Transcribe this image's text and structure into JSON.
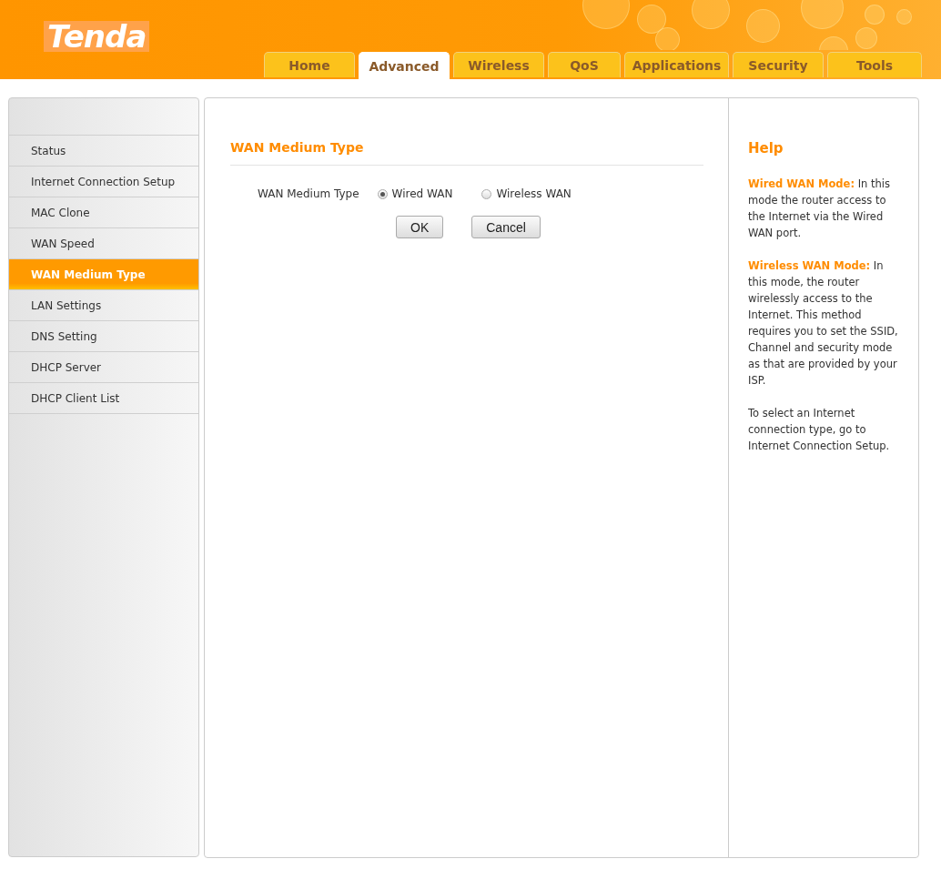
{
  "logo": "Tenda",
  "tabs": [
    {
      "label": "Home",
      "selected": false
    },
    {
      "label": "Advanced",
      "selected": true
    },
    {
      "label": "Wireless",
      "selected": false
    },
    {
      "label": "QoS",
      "selected": false
    },
    {
      "label": "Applications",
      "selected": false
    },
    {
      "label": "Security",
      "selected": false
    },
    {
      "label": "Tools",
      "selected": false
    }
  ],
  "sidebar": {
    "items": [
      {
        "label": "Status",
        "selected": false
      },
      {
        "label": "Internet Connection Setup",
        "selected": false
      },
      {
        "label": "MAC Clone",
        "selected": false
      },
      {
        "label": "WAN Speed",
        "selected": false
      },
      {
        "label": "WAN Medium Type",
        "selected": true
      },
      {
        "label": "LAN Settings",
        "selected": false
      },
      {
        "label": "DNS Setting",
        "selected": false
      },
      {
        "label": "DHCP Server",
        "selected": false
      },
      {
        "label": "DHCP Client List",
        "selected": false
      }
    ]
  },
  "form": {
    "title": "WAN Medium Type",
    "field_label": "WAN Medium Type",
    "options": [
      {
        "label": "Wired WAN",
        "selected": true
      },
      {
        "label": "Wireless WAN",
        "selected": false
      }
    ],
    "buttons": [
      "OK",
      "Cancel"
    ]
  },
  "help": {
    "title": "Help",
    "paragraphs": [
      "**Wired WAN Mode:**  In this mode the router access to the Internet via the Wired WAN port.",
      "**Wireless WAN Mode:**  In this mode, the router wirelessly access to the Internet. This method requires you to set the SSID, Channel and security mode as that are provided by your ISP.",
      "To select an Internet connection type, go to Internet Connection Setup."
    ]
  }
}
